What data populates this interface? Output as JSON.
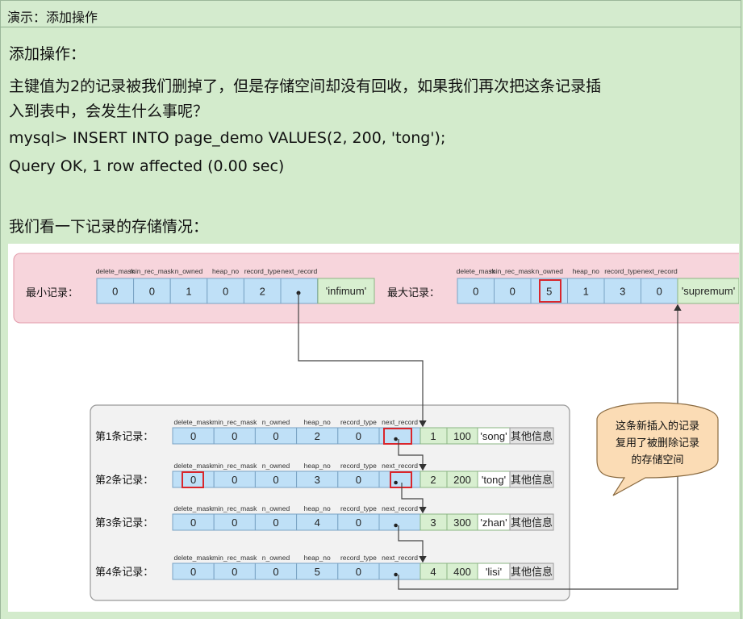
{
  "header": {
    "title": "演示：添加操作"
  },
  "content": {
    "heading": "添加操作：",
    "para_line1": "主键值为2的记录被我们删掉了，但是存储空间却没有回收，如果我们再次把这条记录插",
    "para_line2": "入到表中，会发生什么事呢？",
    "sql": "mysql> INSERT INTO page_demo VALUES(2, 200, 'tong');",
    "result": "Query OK, 1 row affected (0.00 sec)",
    "sub_heading": "我们看一下记录的存储情况："
  },
  "diagram": {
    "field_headers": [
      "delete_mask",
      "min_rec_mask",
      "n_owned",
      "heap_no",
      "record_type",
      "next_record"
    ],
    "min_record": {
      "label": "最小记录：",
      "values": [
        "0",
        "0",
        "1",
        "0",
        "2",
        ""
      ],
      "extra": "'infimum'"
    },
    "max_record": {
      "label": "最大记录：",
      "values": [
        "0",
        "0",
        "5",
        "1",
        "3",
        "0"
      ],
      "extra": "'supremum'"
    },
    "records": [
      {
        "label": "第1条记录：",
        "values": [
          "0",
          "0",
          "0",
          "2",
          "0",
          ""
        ],
        "id": "1",
        "num": "100",
        "str": "'song'",
        "other": "其他信息"
      },
      {
        "label": "第2条记录：",
        "values": [
          "0",
          "0",
          "0",
          "3",
          "0",
          ""
        ],
        "id": "2",
        "num": "200",
        "str": "'tong'",
        "other": "其他信息"
      },
      {
        "label": "第3条记录：",
        "values": [
          "0",
          "0",
          "0",
          "4",
          "0",
          ""
        ],
        "id": "3",
        "num": "300",
        "str": "'zhan'",
        "other": "其他信息"
      },
      {
        "label": "第4条记录：",
        "values": [
          "0",
          "0",
          "0",
          "5",
          "0",
          ""
        ],
        "id": "4",
        "num": "400",
        "str": "'lisi'",
        "other": "其他信息"
      }
    ],
    "callout": [
      "这条新插入的记录",
      "复用了被删除记录",
      "的存储空间"
    ],
    "colors": {
      "cell_blue": "#bfe0f7",
      "cell_green": "#d8efd0",
      "pink_bg": "#f7d5dc",
      "highlight_red": "#d9262c",
      "callout_fill": "#fbdcb5"
    }
  }
}
